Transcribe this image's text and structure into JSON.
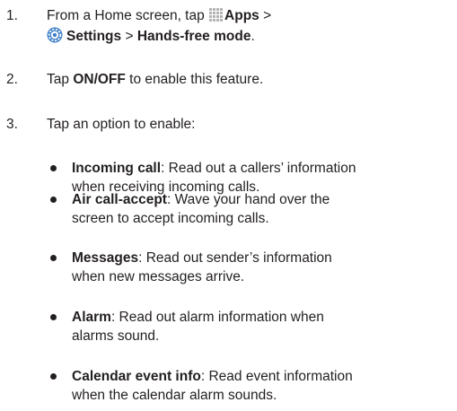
{
  "steps": [
    {
      "number": "1.",
      "line1_a": "From a Home screen, tap ",
      "apps_label": "Apps",
      "line1_b": " >",
      "settings_label": "Settings",
      "line2_mid": " > ",
      "handsfree_label": "Hands-free mode",
      "line2_end": "."
    },
    {
      "number": "2.",
      "text_a": "Tap ",
      "onoff_label": "ON/OFF",
      "text_b": " to enable this feature."
    },
    {
      "number": "3.",
      "text": "Tap an option to enable:"
    }
  ],
  "options": [
    {
      "name": "Incoming call",
      "line1": ": Read out a callers’ information",
      "line2": "when receiving incoming calls."
    },
    {
      "name": "Air call-accept",
      "line1": ": Wave your hand over the",
      "line2": "screen to accept incoming calls."
    },
    {
      "name": "Messages",
      "line1": ": Read out sender’s information",
      "line2": "when new messages arrive."
    },
    {
      "name": "Alarm",
      "line1": ": Read out alarm information when",
      "line2": "alarms sound."
    },
    {
      "name": "Calendar event info",
      "line1": ": Read event information",
      "line2": "when the calendar alarm sounds."
    }
  ],
  "icons": {
    "apps": "apps-grid-icon",
    "settings": "settings-gear-icon",
    "gear_color": "#3d7fc8"
  }
}
